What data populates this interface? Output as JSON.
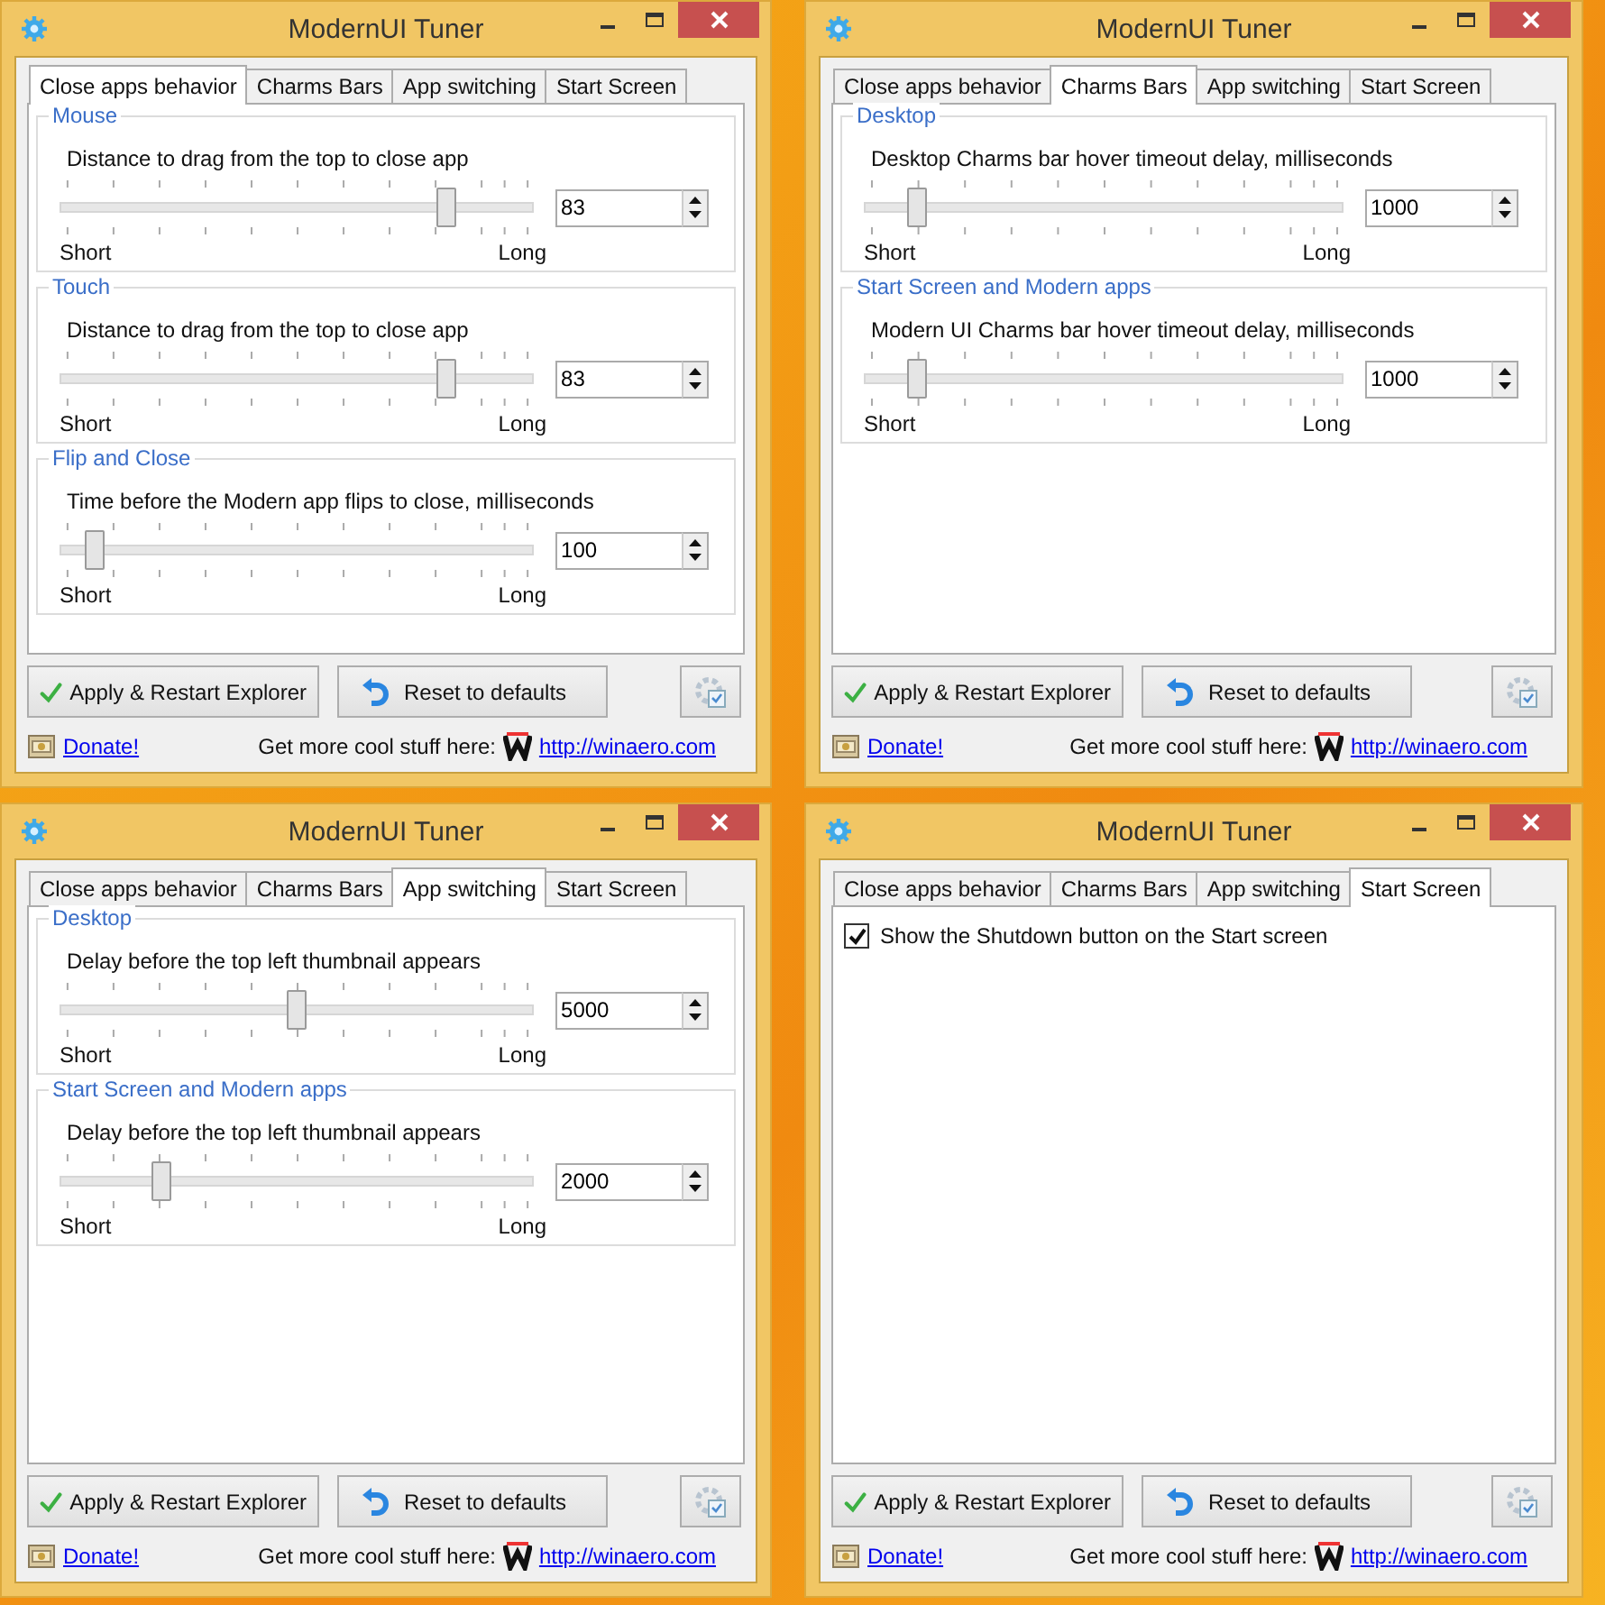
{
  "windows": [
    {
      "title": "ModernUI Tuner",
      "tabs": [
        {
          "label": "Close apps behavior",
          "selected": true
        },
        {
          "label": "Charms Bars",
          "selected": false
        },
        {
          "label": "App switching",
          "selected": false
        },
        {
          "label": "Start Screen",
          "selected": false
        }
      ],
      "items": [
        {
          "kind": "group",
          "title": "Mouse",
          "label": "Distance to drag from the top to close app",
          "level": 0.83,
          "value": "83",
          "min_label": "Short",
          "max_label": "Long"
        },
        {
          "kind": "group",
          "title": "Touch",
          "label": "Distance to drag from the top to close app",
          "level": 0.83,
          "value": "83",
          "min_label": "Short",
          "max_label": "Long"
        },
        {
          "kind": "group",
          "title": "Flip and Close",
          "label": "Time before the Modern app flips to close, milliseconds",
          "level": 0.05,
          "value": "100",
          "min_label": "Short",
          "max_label": "Long"
        }
      ],
      "buttons": [
        "Apply & Restart Explorer",
        "Reset to defaults"
      ],
      "donate": "Donate!",
      "promo": "Get more cool stuff here:",
      "url": "http://winaero.com"
    },
    {
      "title": "ModernUI Tuner",
      "tabs": [
        {
          "label": "Close apps behavior",
          "selected": false
        },
        {
          "label": "Charms Bars",
          "selected": true
        },
        {
          "label": "App switching",
          "selected": false
        },
        {
          "label": "Start Screen",
          "selected": false
        }
      ],
      "items": [
        {
          "kind": "group",
          "title": "Desktop",
          "label": "Desktop Charms bar hover timeout delay, milliseconds",
          "level": 0.09,
          "value": "1000",
          "min_label": "Short",
          "max_label": "Long"
        },
        {
          "kind": "group",
          "title": "Start Screen and Modern apps",
          "label": "Modern UI Charms bar hover timeout delay, milliseconds",
          "level": 0.09,
          "value": "1000",
          "min_label": "Short",
          "max_label": "Long"
        }
      ],
      "buttons": [
        "Apply & Restart Explorer",
        "Reset to defaults"
      ],
      "donate": "Donate!",
      "promo": "Get more cool stuff here:",
      "url": "http://winaero.com"
    },
    {
      "title": "ModernUI Tuner",
      "tabs": [
        {
          "label": "Close apps behavior",
          "selected": false
        },
        {
          "label": "Charms Bars",
          "selected": false
        },
        {
          "label": "App switching",
          "selected": true
        },
        {
          "label": "Start Screen",
          "selected": false
        }
      ],
      "items": [
        {
          "kind": "group",
          "title": "Desktop",
          "label": "Delay before the top left thumbnail appears",
          "level": 0.5,
          "value": "5000",
          "min_label": "Short",
          "max_label": "Long"
        },
        {
          "kind": "group",
          "title": "Start Screen and Modern apps",
          "label": "Delay before the top left thumbnail appears",
          "level": 0.2,
          "value": "2000",
          "min_label": "Short",
          "max_label": "Long"
        }
      ],
      "buttons": [
        "Apply & Restart Explorer",
        "Reset to defaults"
      ],
      "donate": "Donate!",
      "promo": "Get more cool stuff here:",
      "url": "http://winaero.com"
    },
    {
      "title": "ModernUI Tuner",
      "tabs": [
        {
          "label": "Close apps behavior",
          "selected": false
        },
        {
          "label": "Charms Bars",
          "selected": false
        },
        {
          "label": "App switching",
          "selected": false
        },
        {
          "label": "Start Screen",
          "selected": true
        }
      ],
      "items": [
        {
          "kind": "checkbox",
          "label": "Show the Shutdown button on the Start screen",
          "checked": true
        }
      ],
      "buttons": [
        "Apply & Restart Explorer",
        "Reset to defaults"
      ],
      "donate": "Donate!",
      "promo": "Get more cool stuff here:",
      "url": "http://winaero.com"
    }
  ]
}
